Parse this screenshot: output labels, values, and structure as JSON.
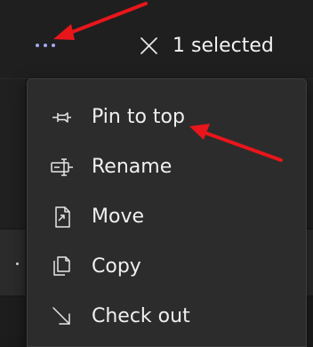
{
  "toolbar": {
    "more_icon": "more-horizontal-icon",
    "close_icon": "close-icon",
    "selection_label": "1 selected"
  },
  "menu": {
    "items": [
      {
        "label": "Pin to top",
        "icon": "pin-icon"
      },
      {
        "label": "Rename",
        "icon": "rename-icon"
      },
      {
        "label": "Move",
        "icon": "move-icon"
      },
      {
        "label": "Copy",
        "icon": "copy-icon"
      },
      {
        "label": "Check out",
        "icon": "check-out-icon"
      }
    ]
  },
  "annotations": {
    "color": "#e8161b"
  },
  "colors": {
    "accent": "#a3a8f5",
    "menu_background": "#2c2c2c",
    "page_background": "#1b1b1b"
  }
}
